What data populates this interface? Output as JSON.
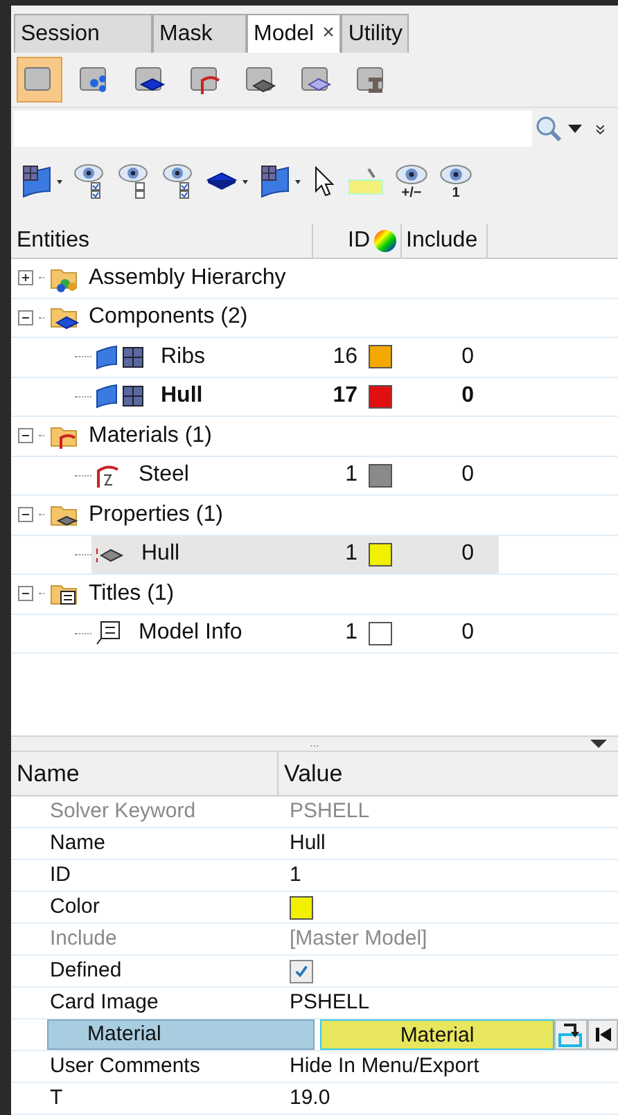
{
  "tabs": [
    {
      "label": "Session",
      "selected": false
    },
    {
      "label": "Mask",
      "selected": false
    },
    {
      "label": "Model",
      "selected": true,
      "close": "×"
    },
    {
      "label": "Utility",
      "selected": false
    }
  ],
  "entity_toolbar": [
    {
      "kind": "blank",
      "selected": true
    },
    {
      "kind": "assembly",
      "selected": false
    },
    {
      "kind": "component",
      "selected": false
    },
    {
      "kind": "material",
      "selected": false
    },
    {
      "kind": "property",
      "selected": false
    },
    {
      "kind": "mesh",
      "selected": false
    },
    {
      "kind": "beam",
      "selected": false
    }
  ],
  "more_glyph": "»",
  "view_toolbar": [
    {
      "kind": "surface-menu"
    },
    {
      "kind": "eye-list"
    },
    {
      "kind": "eye-list-empty"
    },
    {
      "kind": "eye-swap"
    },
    {
      "kind": "solid-menu"
    },
    {
      "kind": "surface-menu"
    },
    {
      "kind": "pointer"
    },
    {
      "kind": "highlight"
    },
    {
      "kind": "eye",
      "caption": "+/−"
    },
    {
      "kind": "eye",
      "caption": "1"
    }
  ],
  "tree": {
    "columns": [
      "Entities",
      "ID",
      "Include"
    ],
    "nodes": [
      {
        "label": "Assembly Hierarchy",
        "kind": "assembly",
        "expanded": false
      },
      {
        "label": "Components (2)",
        "kind": "component",
        "expanded": true,
        "children": [
          {
            "label": "Ribs",
            "kind": "component",
            "id": "16",
            "color": "#f5a800",
            "include": "0",
            "bold": false,
            "selected": false
          },
          {
            "label": "Hull",
            "kind": "component",
            "id": "17",
            "color": "#e01010",
            "include": "0",
            "bold": true,
            "selected": false
          }
        ]
      },
      {
        "label": "Materials (1)",
        "kind": "material",
        "expanded": true,
        "children": [
          {
            "label": "Steel",
            "kind": "material",
            "id": "1",
            "color": "#8a8a8a",
            "include": "0",
            "bold": false,
            "selected": false
          }
        ]
      },
      {
        "label": "Properties (1)",
        "kind": "property",
        "expanded": true,
        "children": [
          {
            "label": "Hull",
            "kind": "property",
            "id": "1",
            "color": "#f0f000",
            "include": "0",
            "bold": false,
            "selected": true
          }
        ]
      },
      {
        "label": "Titles (1)",
        "kind": "title",
        "expanded": true,
        "children": [
          {
            "label": "Model Info",
            "kind": "title",
            "id": "1",
            "color": "#ffffff",
            "include": "0",
            "bold": false,
            "selected": false
          }
        ]
      }
    ]
  },
  "splitter": "...",
  "properties": {
    "columns": [
      "Name",
      "Value"
    ],
    "rows": [
      {
        "name": "Solver Keyword",
        "kind": "text",
        "value": "PSHELL",
        "disabled": true,
        "selected": false
      },
      {
        "name": "Name",
        "kind": "text",
        "value": "Hull",
        "disabled": false,
        "selected": false
      },
      {
        "name": "ID",
        "kind": "text",
        "value": "1",
        "disabled": false,
        "selected": false
      },
      {
        "name": "Color",
        "kind": "color",
        "color": "#f0f000",
        "disabled": false,
        "selected": false
      },
      {
        "name": "Include",
        "kind": "text",
        "value": "[Master Model]",
        "disabled": true,
        "selected": false
      },
      {
        "name": "Defined",
        "kind": "checkbox",
        "checked": true,
        "disabled": false,
        "selected": false
      },
      {
        "name": "Card Image",
        "kind": "text",
        "value": "PSHELL",
        "disabled": false,
        "selected": false
      },
      {
        "name": "Material",
        "kind": "selector",
        "value": "Material",
        "disabled": false,
        "selected": true
      },
      {
        "name": "User Comments",
        "kind": "text",
        "value": "Hide In Menu/Export",
        "disabled": false,
        "selected": false
      },
      {
        "name": "T",
        "kind": "text",
        "value": "19.0",
        "disabled": false,
        "selected": false
      }
    ]
  }
}
